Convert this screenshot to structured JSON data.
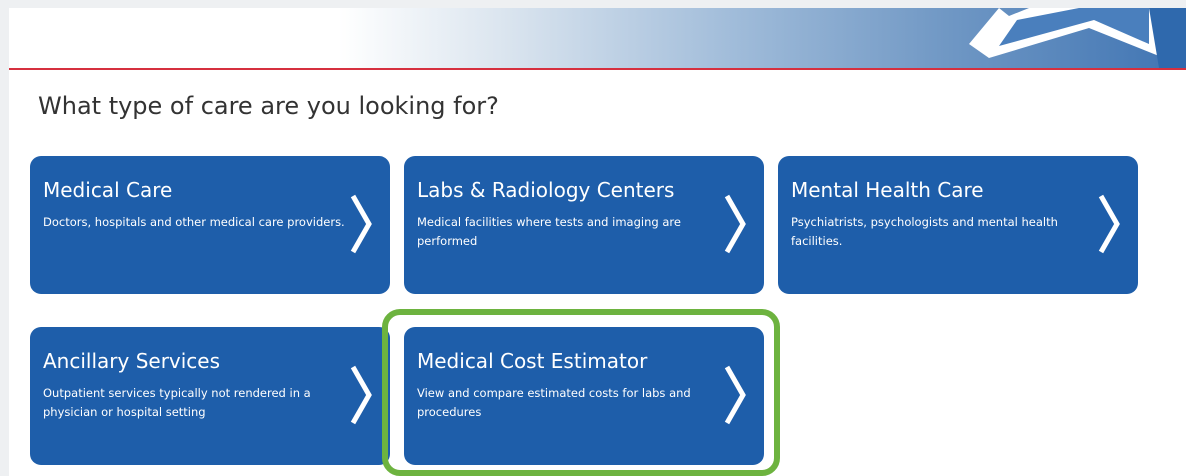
{
  "banner": {
    "accent_line_color": "#d6303f",
    "logo_icon": "star-icon"
  },
  "heading": "What type of care are you looking for?",
  "cards": [
    {
      "title": "Medical Care",
      "description": "Doctors, hospitals and other medical care providers.",
      "icon": "chevron-right-icon"
    },
    {
      "title": "Labs & Radiology Centers",
      "description": "Medical facilities where tests and imaging are performed",
      "icon": "chevron-right-icon"
    },
    {
      "title": "Mental Health Care",
      "description": "Psychiatrists, psychologists and mental health facilities.",
      "icon": "chevron-right-icon"
    },
    {
      "title": "Ancillary Services",
      "description": "Outpatient services typically not rendered in a physician or hospital setting",
      "icon": "chevron-right-icon"
    },
    {
      "title": "Medical Cost Estimator",
      "description": "View and compare estimated costs for labs and procedures",
      "icon": "chevron-right-icon",
      "highlighted": true
    }
  ],
  "colors": {
    "card_background": "#1e5eaa",
    "highlight_border": "#6db33f",
    "heading_text": "#333333"
  }
}
